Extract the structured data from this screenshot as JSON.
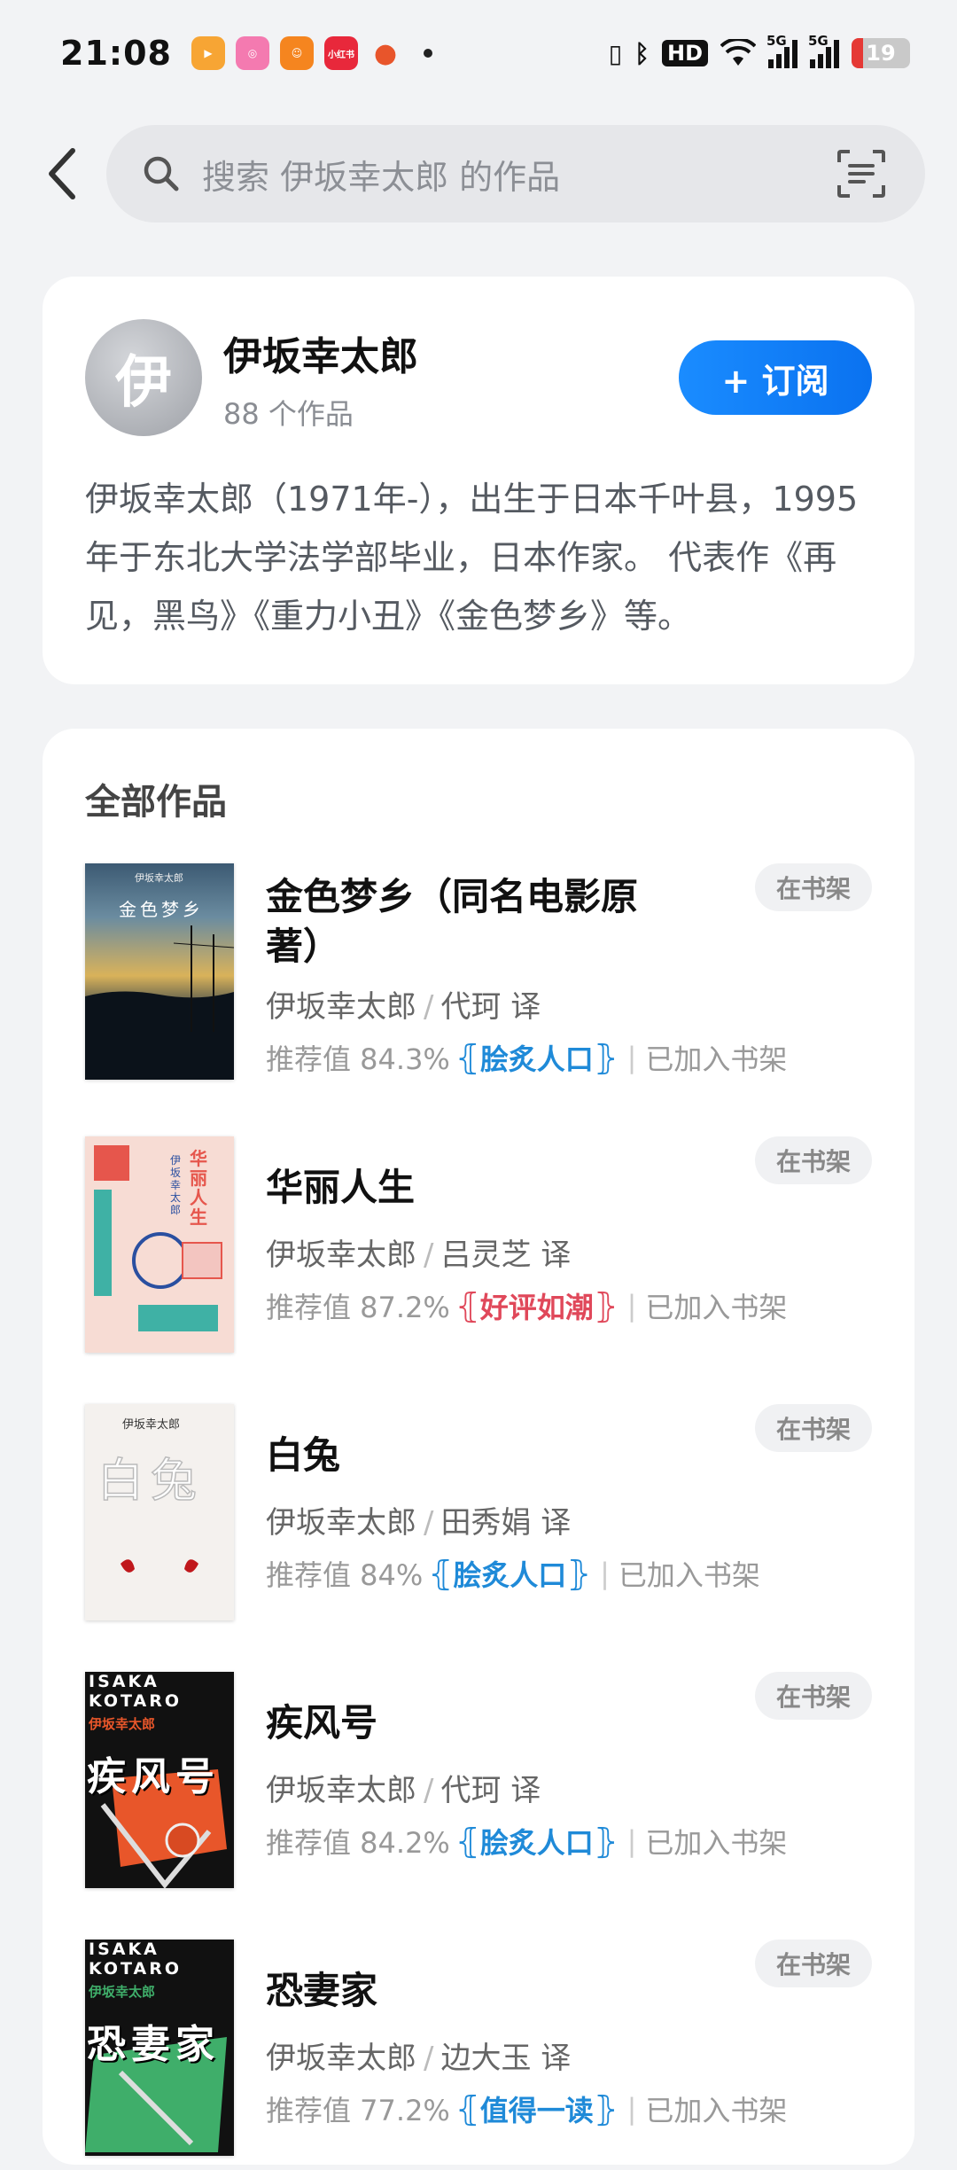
{
  "status": {
    "time": "21:08",
    "app_icons": [
      {
        "name": "app-green-icon",
        "color": "#f7a534"
      },
      {
        "name": "app-pink-icon",
        "color": "#f47ab0"
      },
      {
        "name": "app-orange-icon",
        "color": "#f5851f"
      },
      {
        "name": "app-red-icon",
        "color": "#e8283b",
        "label": "小红书"
      },
      {
        "name": "app-game-icon",
        "color": "#e8552b"
      }
    ],
    "hd": "HD",
    "net1": "5G",
    "net2": "5G",
    "battery": "19"
  },
  "search": {
    "placeholder": "搜索 伊坂幸太郎 的作品"
  },
  "author": {
    "avatar_char": "伊",
    "name": "伊坂幸太郎",
    "count": "88 个作品",
    "subscribe_label": "+ 订阅",
    "description": "伊坂幸太郎（1971年-），出生于日本千叶县，1995年于东北大学法学部毕业，日本作家。 代表作《再见，黑鸟》《重力小丑》《金色梦乡》等。"
  },
  "works": {
    "section_title": "全部作品",
    "shelf_label": "在书架",
    "added_label": "已加入书架",
    "books": [
      {
        "title": "金色梦乡（同名电影原著）",
        "author": "伊坂幸太郎",
        "translator": "代珂 译",
        "rec": "推荐值 84.3%",
        "badge": "脍炙人口",
        "badge_color": "blue"
      },
      {
        "title": "华丽人生",
        "author": "伊坂幸太郎",
        "translator": "吕灵芝 译",
        "rec": "推荐值 87.2%",
        "badge": "好评如潮",
        "badge_color": "red"
      },
      {
        "title": "白兔",
        "author": "伊坂幸太郎",
        "translator": "田秀娟 译",
        "rec": "推荐值 84%",
        "badge": "脍炙人口",
        "badge_color": "blue"
      },
      {
        "title": "疾风号",
        "author": "伊坂幸太郎",
        "translator": "代珂 译",
        "rec": "推荐值 84.2%",
        "badge": "脍炙人口",
        "badge_color": "blue"
      },
      {
        "title": "恐妻家",
        "author": "伊坂幸太郎",
        "translator": "边大玉 译",
        "rec": "推荐值 77.2%",
        "badge": "值得一读",
        "badge_color": "blue"
      }
    ]
  },
  "covers": {
    "c1_author": "伊坂幸太郎",
    "c1_title": "金色梦乡",
    "c2_title": "华丽人生",
    "c2_author": "伊坂幸太郎",
    "c3_author": "伊坂幸太郎",
    "c3_title": "白兔",
    "c4_latin": "ISAKA KOTARO",
    "c4_author": "伊坂幸太郎",
    "c4_title": "疾风号",
    "c5_latin": "ISAKA KOTARO",
    "c5_author": "伊坂幸太郎",
    "c5_title": "恐妻家"
  }
}
